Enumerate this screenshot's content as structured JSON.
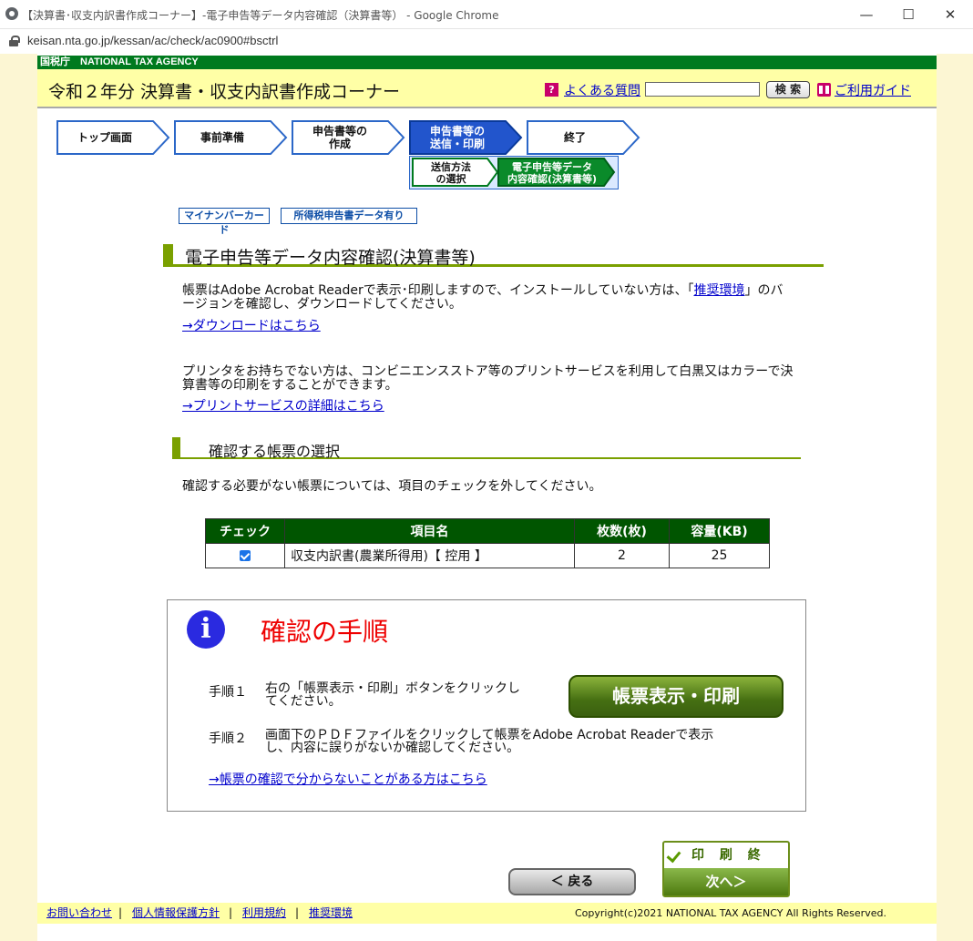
{
  "window": {
    "title": "【決算書･収支内訳書作成コーナー】-電子申告等データ内容確認（決算書等） - Google Chrome",
    "url": "keisan.nta.go.jp/kessan/ac/check/ac0900#bsctrl",
    "minimize": "—",
    "maximize": "☐",
    "close": "✕"
  },
  "header": {
    "agency": "国税庁　NATIONAL TAX AGENCY",
    "corner_title": "令和２年分 決算書・収支内訳書作成コーナー",
    "faq_label": "よくある質問",
    "faq_icon": "?",
    "search_button": "検 索",
    "guide_label": "ご利用ガイド"
  },
  "steps": [
    {
      "label": "トップ画面"
    },
    {
      "label": "事前準備"
    },
    {
      "label1": "申告書等の",
      "label2": "作成"
    },
    {
      "label1": "申告書等の",
      "label2": "送信・印刷"
    },
    {
      "label": "終了"
    }
  ],
  "substeps": [
    {
      "label1": "送信方法",
      "label2": "の選択"
    },
    {
      "label1": "電子申告等データ",
      "label2": "内容確認(決算書等)"
    }
  ],
  "badges": [
    "マイナンバーカード",
    "所得税申告書データ有り"
  ],
  "main": {
    "heading": "電子申告等データ内容確認(決算書等)",
    "para1_a": "帳票はAdobe Acrobat Readerで表示･印刷しますので、インストールしていない方は、「",
    "para1_link": "推奨環境",
    "para1_b": "」のバ",
    "para1_c": "ージョンを確認し、ダウンロードしてください。",
    "download_link": "→ダウンロードはこちら",
    "para2_a": "プリンタをお持ちでない方は、コンビニエンスストア等のプリントサービスを利用して白黒又はカラーで決",
    "para2_b": "算書等の印刷をすることができます。",
    "print_service_link": "→プリントサービスの詳細はこちら",
    "subheading": "確認する帳票の選択",
    "instruction": "確認する必要がない帳票については、項目のチェックを外してください。"
  },
  "table": {
    "headers": [
      "チェック",
      "項目名",
      "枚数(枚)",
      "容量(KB)"
    ],
    "rows": [
      {
        "checked": true,
        "name": "収支内訳書(農業所得用)【 控用 】",
        "sheets": "2",
        "size": "25"
      }
    ]
  },
  "info": {
    "icon": "i",
    "title": "確認の手順",
    "step1_label": "手順１",
    "step1_text_a": "右の「帳票表示・印刷」ボタンをクリックし",
    "step1_text_b": "てください。",
    "print_button": "帳票表示・印刷",
    "step2_label": "手順２",
    "step2_text_a": "画面下のＰＤＦファイルをクリックして帳票をAdobe Acrobat Readerで表示",
    "step2_text_b": "し、内容に誤りがないか確認してください。",
    "help_link": "→帳票の確認で分からないことがある方はこちら"
  },
  "nav": {
    "back": "＜ 戻る",
    "finish_print": "印 刷 終 了",
    "next": "次へ＞"
  },
  "footer": {
    "links": [
      "お問い合わせ",
      "個人情報保護方針",
      "利用規約",
      "推奨環境"
    ],
    "separator": "|",
    "copyright": "Copyright(c)2021 NATIONAL TAX AGENCY All Rights Reserved."
  }
}
